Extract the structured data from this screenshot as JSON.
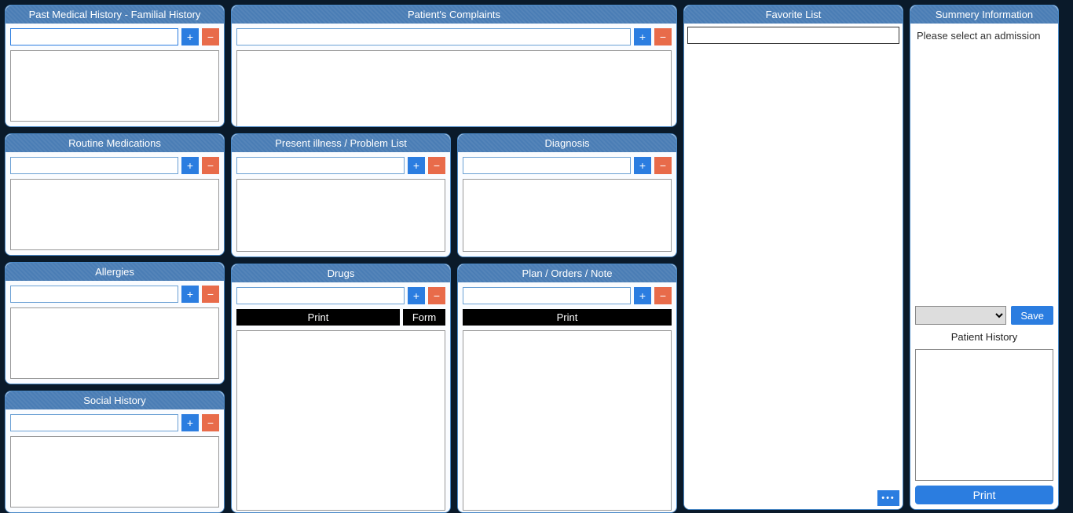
{
  "buttons": {
    "add": "+",
    "remove": "−",
    "more": "•••",
    "save": "Save",
    "print_wide": "Print"
  },
  "col1": {
    "pmh": {
      "title": "Past Medical History - Familial History"
    },
    "routine": {
      "title": "Routine Medications"
    },
    "allergies": {
      "title": "Allergies"
    },
    "social": {
      "title": "Social History"
    }
  },
  "col2": {
    "complaints": {
      "title": "Patient's Complaints"
    },
    "present": {
      "title": "Present illness / Problem List"
    },
    "diagnosis": {
      "title": "Diagnosis"
    },
    "drugs": {
      "title": "Drugs",
      "sub_print": "Print",
      "sub_form": "Form"
    },
    "plan": {
      "title": "Plan / Orders / Note",
      "sub_print": "Print"
    }
  },
  "favorite": {
    "title": "Favorite List"
  },
  "summary": {
    "title": "Summery Information",
    "message": "Please select an admission",
    "patient_history_label": "Patient History"
  }
}
